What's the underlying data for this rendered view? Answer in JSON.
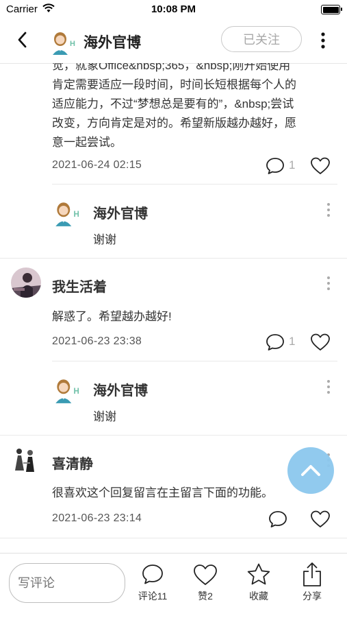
{
  "status": {
    "carrier": "Carrier",
    "time": "10:08 PM"
  },
  "header": {
    "title": "海外官博",
    "follow_label": "已关注"
  },
  "comments": [
    {
      "text_lines": [
        "觉，就象Office&nbsp;365，&nbsp;刚开始使用",
        "肯定需要适应一段时间，时间长短根据每个人的",
        "适应能力，不过“梦想总是要有的”，&nbsp;尝试",
        "改变，方向肯定是对的。希望新版越办越好，愿",
        "意一起尝试。"
      ],
      "time": "2021-06-24 02:15",
      "reply_count": "1",
      "reply": {
        "author": "海外官博",
        "text": "谢谢"
      }
    },
    {
      "author": "我生活着",
      "text": "解惑了。希望越办越好!",
      "time": "2021-06-23 23:38",
      "reply_count": "1",
      "reply": {
        "author": "海外官博",
        "text": "谢谢"
      }
    },
    {
      "author": "喜清静",
      "text": "很喜欢这个回复留言在主留言下面的功能。",
      "time": "2021-06-23 23:14"
    }
  ],
  "bottom": {
    "input_placeholder": "写评论",
    "comment_label": "评论11",
    "like_label": "赞2",
    "fav_label": "收藏",
    "share_label": "分享"
  }
}
